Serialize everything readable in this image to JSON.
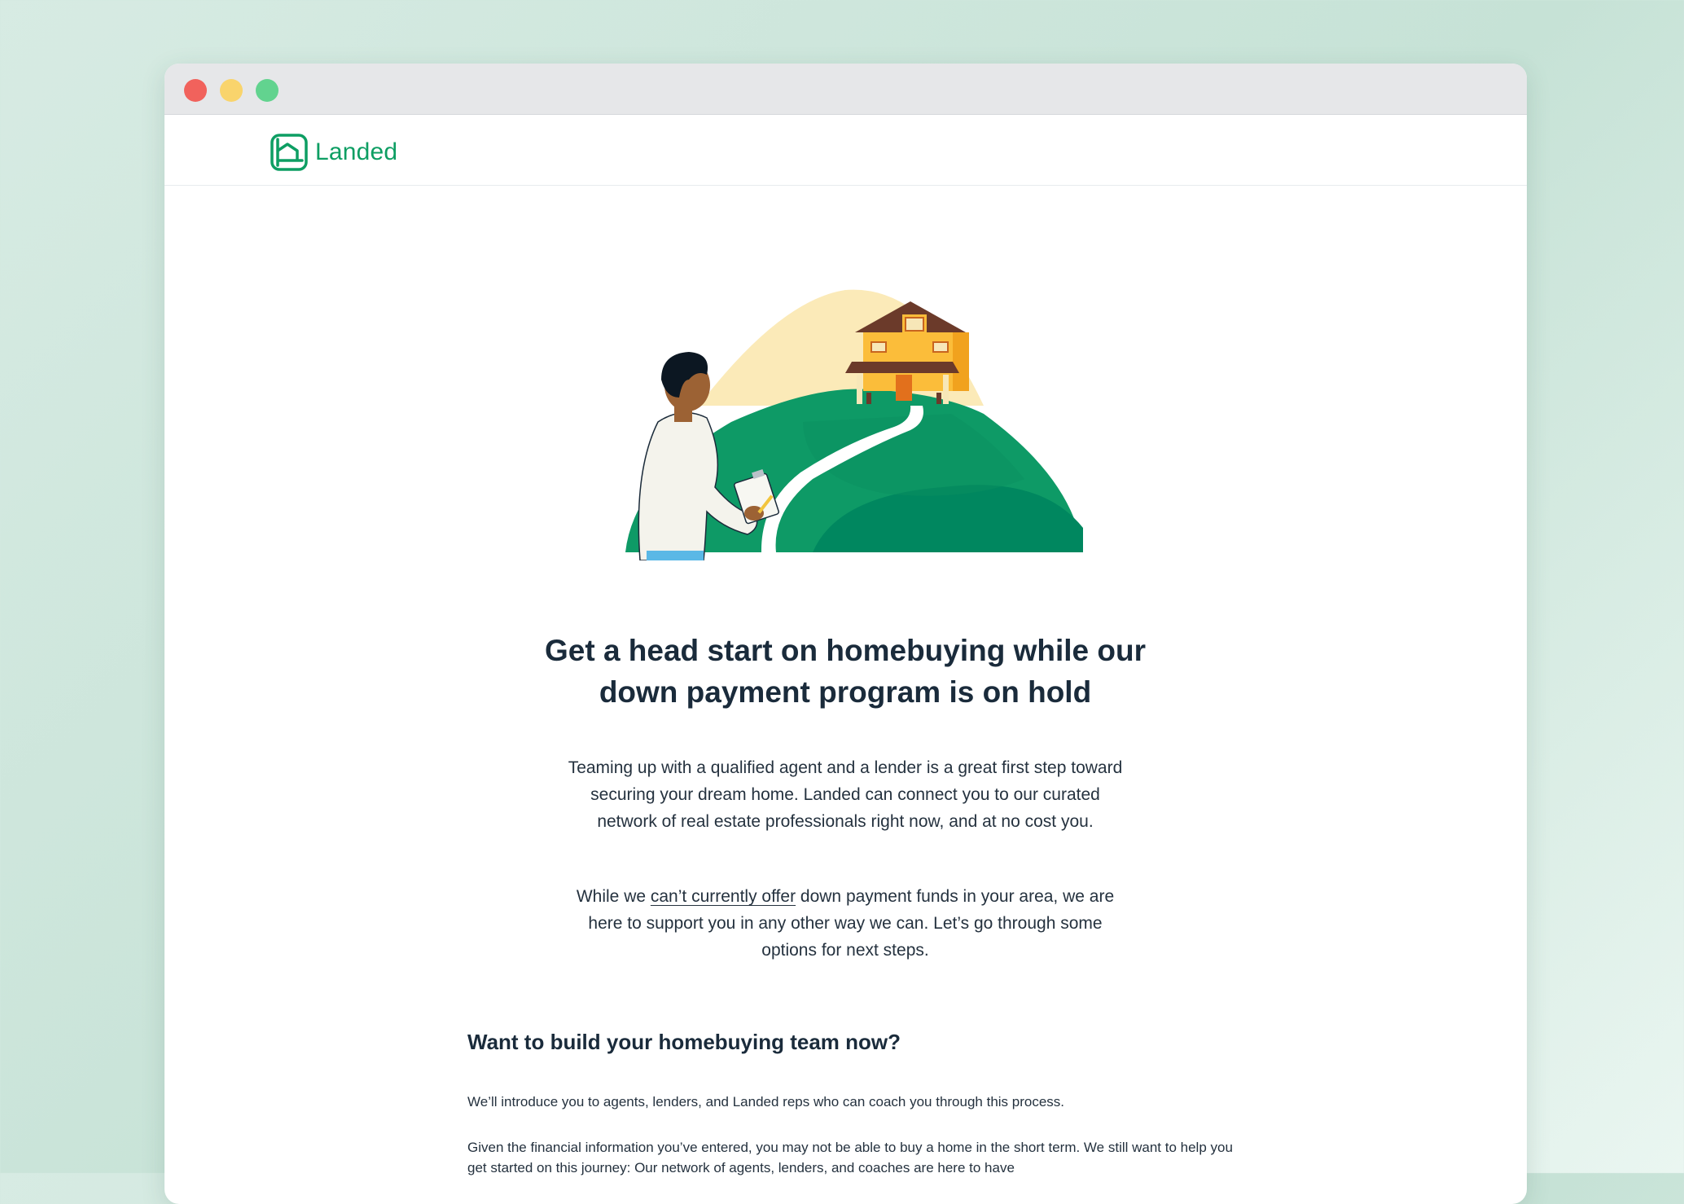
{
  "browser": {
    "buttons": [
      "close",
      "minimize",
      "maximize"
    ]
  },
  "brand": {
    "name": "Landed",
    "color": "#0d9e63",
    "logo_icon": "house-frame-icon"
  },
  "hero": {
    "illustration": "person-with-clipboard-looking-at-house-on-hill"
  },
  "main": {
    "headline": "Get a head start on homebuying while our down payment program is on hold",
    "intro": "Teaming up with a qualified agent and a lender is a great first step toward securing your dream home. Landed can connect you to our curated network of real estate professionals right now, and at no cost you.",
    "support_before": "While we ",
    "support_link": "can’t currently offer",
    "support_after": " down payment funds in your area, we are here to support you in any other way we can. Let’s go through some options for next steps."
  },
  "team_section": {
    "title": "Want to build your homebuying team now?",
    "intro": "We’ll introduce you to agents, lenders, and Landed reps who can coach you through this process.",
    "detail": "Given the financial information you’ve entered, you may not be able to buy a home in the short term. We still want to help you get started on this journey: Our network of agents, lenders, and coaches are here to have"
  }
}
